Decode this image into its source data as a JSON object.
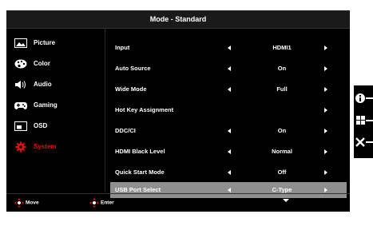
{
  "title": "Mode - Standard",
  "sidebar": {
    "items": [
      {
        "label": "Picture",
        "icon": "picture-icon"
      },
      {
        "label": "Color",
        "icon": "palette-icon"
      },
      {
        "label": "Audio",
        "icon": "speaker-icon"
      },
      {
        "label": "Gaming",
        "icon": "gamepad-icon"
      },
      {
        "label": "OSD",
        "icon": "osd-window-icon"
      },
      {
        "label": "System",
        "icon": "gear-icon",
        "active": true
      }
    ]
  },
  "settings": {
    "rows": [
      {
        "name": "Input",
        "value": "HDMI1",
        "left_arrow": true,
        "right_arrow": true
      },
      {
        "name": "Auto Source",
        "value": "On",
        "left_arrow": true,
        "right_arrow": true
      },
      {
        "name": "Wide Mode",
        "value": "Full",
        "left_arrow": true,
        "right_arrow": true
      },
      {
        "name": "Hot Key Assignment",
        "value": "",
        "left_arrow": false,
        "right_arrow": true
      },
      {
        "name": "DDC/CI",
        "value": "On",
        "left_arrow": true,
        "right_arrow": true
      },
      {
        "name": "HDMI Black Level",
        "value": "Normal",
        "left_arrow": true,
        "right_arrow": true
      },
      {
        "name": "Quick Start Mode",
        "value": "Off",
        "left_arrow": true,
        "right_arrow": true
      },
      {
        "name": "USB Port Select",
        "value": "C-Type",
        "left_arrow": true,
        "right_arrow": true,
        "selected": true
      }
    ]
  },
  "footer": {
    "move_label": "Move",
    "enter_label": "Enter"
  },
  "side_buttons": [
    "info-icon",
    "grid-icon",
    "close-icon"
  ],
  "colors": {
    "accent": "#e01010",
    "selected_row": "#8f8f8f",
    "background": "#000000"
  }
}
